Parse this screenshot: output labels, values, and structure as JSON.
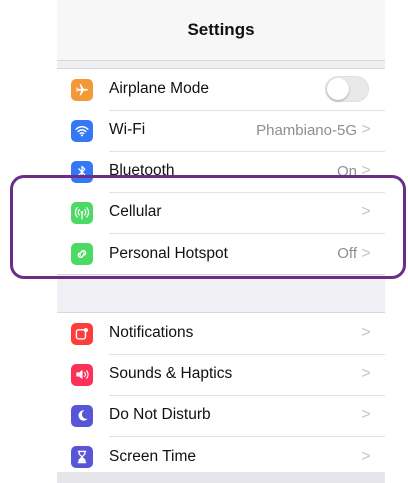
{
  "navbar": {
    "title": "Settings"
  },
  "group1": [
    {
      "label": "Airplane Mode",
      "icon": "airplane-icon",
      "color": "#f19a37",
      "type": "toggle",
      "toggle_on": false
    },
    {
      "label": "Wi-Fi",
      "icon": "wifi-icon",
      "color": "#3478f6",
      "value": "Phambiano-5G",
      "type": "chevron"
    },
    {
      "label": "Bluetooth",
      "icon": "bluetooth-icon",
      "color": "#3478f6",
      "value": "On",
      "type": "chevron"
    },
    {
      "label": "Cellular",
      "icon": "cellular-icon",
      "color": "#4cd964",
      "value": "",
      "type": "chevron"
    },
    {
      "label": "Personal Hotspot",
      "icon": "hotspot-icon",
      "color": "#4cd964",
      "value": "Off",
      "type": "chevron"
    }
  ],
  "group2": [
    {
      "label": "Notifications",
      "icon": "notifications-icon",
      "color": "#fc3d39",
      "type": "chevron"
    },
    {
      "label": "Sounds & Haptics",
      "icon": "sounds-icon",
      "color": "#fc3158",
      "type": "chevron"
    },
    {
      "label": "Do Not Disturb",
      "icon": "moon-icon",
      "color": "#5856d6",
      "type": "chevron"
    },
    {
      "label": "Screen Time",
      "icon": "hourglass-icon",
      "color": "#5856d6",
      "type": "chevron"
    }
  ],
  "chevron_glyph": ">",
  "highlight_color": "#6a2e86"
}
